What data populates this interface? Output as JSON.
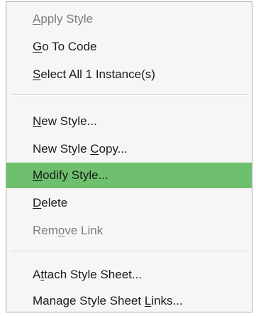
{
  "context_menu": {
    "items": [
      {
        "id": "apply-style",
        "pre": "",
        "key": "A",
        "post": "pply Style",
        "enabled": false
      },
      {
        "id": "go-to-code",
        "pre": "",
        "key": "G",
        "post": "o To Code",
        "enabled": true
      },
      {
        "id": "select-all-instances",
        "pre": "",
        "key": "S",
        "post": "elect All 1 Instance(s)",
        "enabled": true
      },
      {
        "id": "new-style",
        "pre": "",
        "key": "N",
        "post": "ew Style...",
        "enabled": true
      },
      {
        "id": "new-style-copy",
        "pre": "New Style ",
        "key": "C",
        "post": "opy...",
        "enabled": true
      },
      {
        "id": "modify-style",
        "pre": "",
        "key": "M",
        "post": "odify Style...",
        "enabled": true,
        "highlighted": true
      },
      {
        "id": "delete",
        "pre": "",
        "key": "D",
        "post": "elete",
        "enabled": true
      },
      {
        "id": "remove-link",
        "pre": "Rem",
        "key": "o",
        "post": "ve Link",
        "enabled": false
      },
      {
        "id": "attach-style-sheet",
        "pre": "A",
        "key": "t",
        "post": "tach Style Sheet...",
        "enabled": true
      },
      {
        "id": "manage-style-sheet-links",
        "pre": "Manage Style Sheet ",
        "key": "L",
        "post": "inks...",
        "enabled": true
      }
    ],
    "colors": {
      "highlight": "#6ec06e",
      "background": "#f6f6f6",
      "text": "#1a1a1a",
      "disabled_text": "#7d7d7d"
    }
  }
}
